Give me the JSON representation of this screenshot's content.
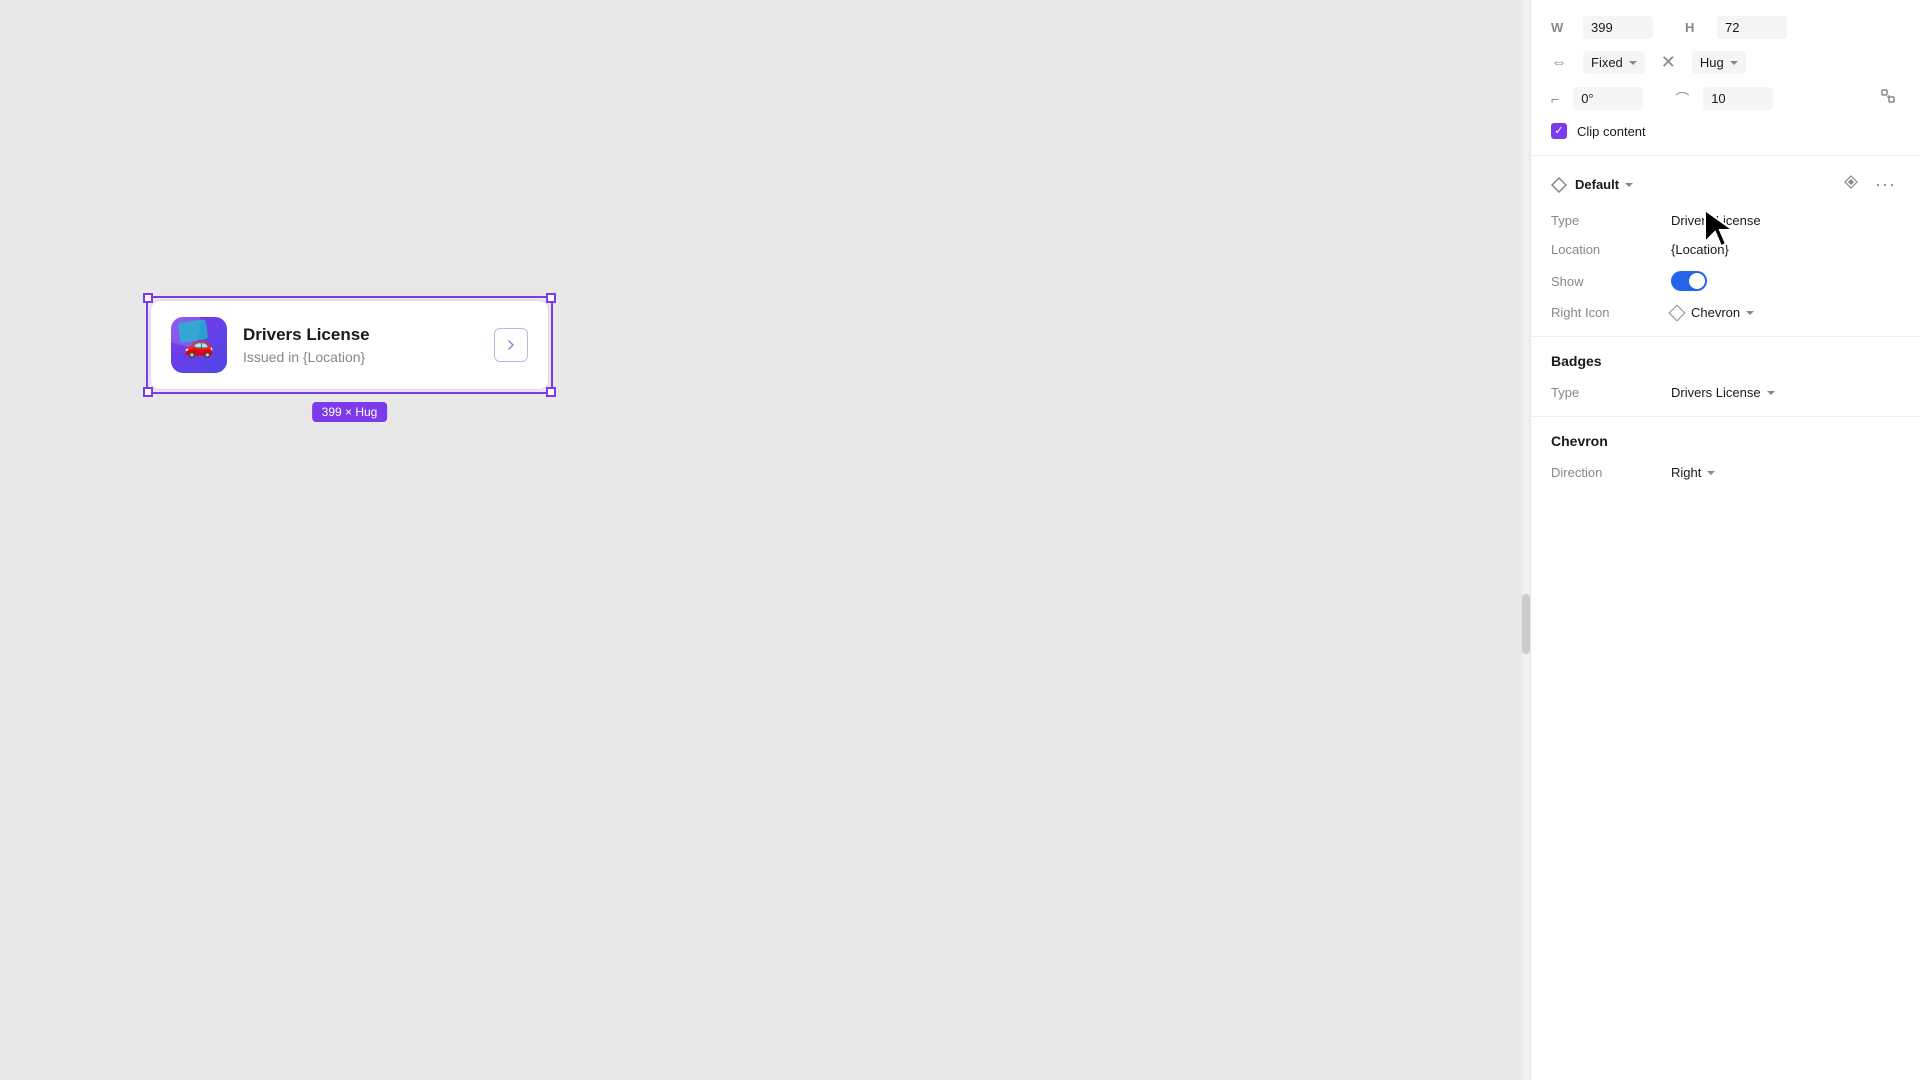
{
  "canvas": {
    "background": "#e8e8e8"
  },
  "card": {
    "title": "Drivers License",
    "subtitle": "Issued in {Location}",
    "size_label": "399 × Hug"
  },
  "panel": {
    "dimensions": {
      "w_label": "W",
      "w_value": "399",
      "h_label": "H",
      "h_value": "72"
    },
    "sizing": {
      "width_mode": "Fixed",
      "height_mode": "Hug"
    },
    "rotation": {
      "label": "0°"
    },
    "corner_radius": {
      "label": "10"
    },
    "clip_content": {
      "label": "Clip content"
    },
    "default_section": {
      "title": "Default",
      "properties": {
        "type_label": "Type",
        "type_value": "Drivers License",
        "location_label": "Location",
        "location_value": "{Location}",
        "show_label": "Show",
        "right_icon_label": "Right Icon",
        "right_icon_value": "Chevron"
      }
    },
    "badges_section": {
      "title": "Badges",
      "type_label": "Type",
      "type_value": "Drivers License"
    },
    "chevron_section": {
      "title": "Chevron",
      "direction_label": "Direction",
      "direction_value": "Right"
    }
  }
}
